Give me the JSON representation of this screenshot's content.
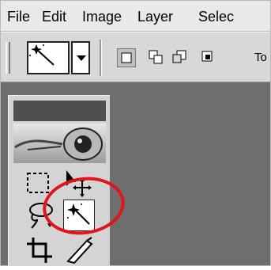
{
  "menu": [
    "File",
    "Edit",
    "Image",
    "Layer",
    "Selec"
  ],
  "options": {
    "right_label": "To"
  },
  "toolbox": {
    "selected_tool": "magic-wand",
    "tools": [
      "rectangular-marquee",
      "move",
      "lasso",
      "magic-wand",
      "crop",
      "slice"
    ]
  },
  "annotation": {
    "highlight_color": "#e0141b"
  }
}
